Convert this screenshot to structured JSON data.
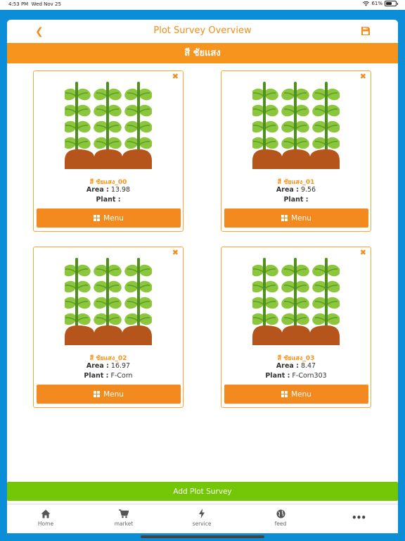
{
  "status_bar": {
    "time": "4:53 PM",
    "date": "Wed Nov 25",
    "battery": "61%",
    "battery_level": 0.61
  },
  "header": {
    "title": "Plot Survey Overview",
    "back_icon": "chevron-left-icon",
    "save_icon": "save-icon"
  },
  "section": {
    "title": "สี ชัยแสง"
  },
  "colors": {
    "accent": "#f7941d",
    "add_button": "#74c707",
    "status_blue": "#0b8dd8"
  },
  "plots": [
    {
      "name": "สี ชัยแสง_00",
      "area_label": "Area :",
      "area": "13.98",
      "plant_label": "Plant :",
      "plant": "",
      "menu_label": "Menu"
    },
    {
      "name": "สี ชัยแสง_01",
      "area_label": "Area :",
      "area": "9.56",
      "plant_label": "Plant :",
      "plant": "",
      "menu_label": "Menu"
    },
    {
      "name": "สี ชัยแสง_02",
      "area_label": "Area :",
      "area": "16.97",
      "plant_label": "Plant :",
      "plant": "F-Corn",
      "menu_label": "Menu"
    },
    {
      "name": "สี ชัยแสง_03",
      "area_label": "Area :",
      "area": "8.47",
      "plant_label": "Plant :",
      "plant": "F-Corn303",
      "menu_label": "Menu"
    }
  ],
  "add_button": {
    "label": "Add Plot Survey"
  },
  "tabs": [
    {
      "label": "Home",
      "icon": "home-icon"
    },
    {
      "label": "market",
      "icon": "cart-icon"
    },
    {
      "label": "service",
      "icon": "bolt-icon"
    },
    {
      "label": "feed",
      "icon": "globe-icon"
    },
    {
      "label": "",
      "icon": "more-icon"
    }
  ]
}
